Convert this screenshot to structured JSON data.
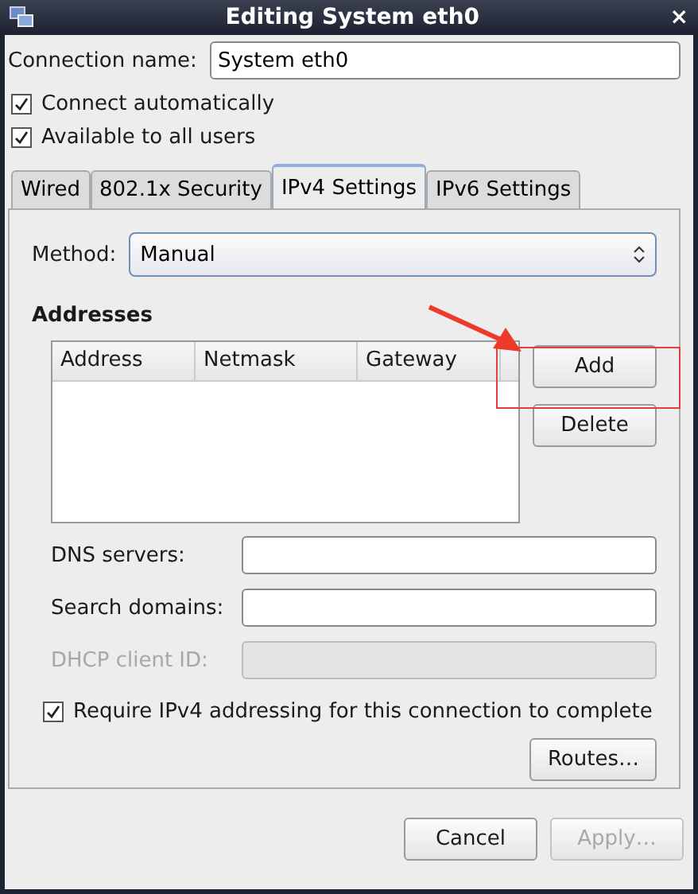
{
  "window": {
    "title": "Editing System eth0",
    "close": "×"
  },
  "connection_name": {
    "label": "Connection name:",
    "value": "System eth0"
  },
  "options": [
    {
      "label": "Connect automatically",
      "checked": true
    },
    {
      "label": "Available to all users",
      "checked": true
    }
  ],
  "tabs": [
    {
      "label": "Wired",
      "selected": false
    },
    {
      "label": "802.1x Security",
      "selected": false
    },
    {
      "label": "IPv4 Settings",
      "selected": true
    },
    {
      "label": "IPv6 Settings",
      "selected": false
    }
  ],
  "method": {
    "label": "Method:",
    "value": "Manual"
  },
  "addresses": {
    "heading": "Addresses",
    "columns": [
      "Address",
      "Netmask",
      "Gateway"
    ],
    "buttons": [
      "Add",
      "Delete"
    ]
  },
  "fields": [
    {
      "label": "DNS servers:",
      "disabled": false
    },
    {
      "label": "Search domains:",
      "disabled": false
    },
    {
      "label": "DHCP client ID:",
      "disabled": true
    }
  ],
  "require": {
    "label": "Require IPv4 addressing for this connection to complete",
    "checked": true
  },
  "routes_button": "Routes…",
  "footer_buttons": [
    {
      "label": "Cancel",
      "disabled": false
    },
    {
      "label": "Apply…",
      "disabled": true
    }
  ]
}
